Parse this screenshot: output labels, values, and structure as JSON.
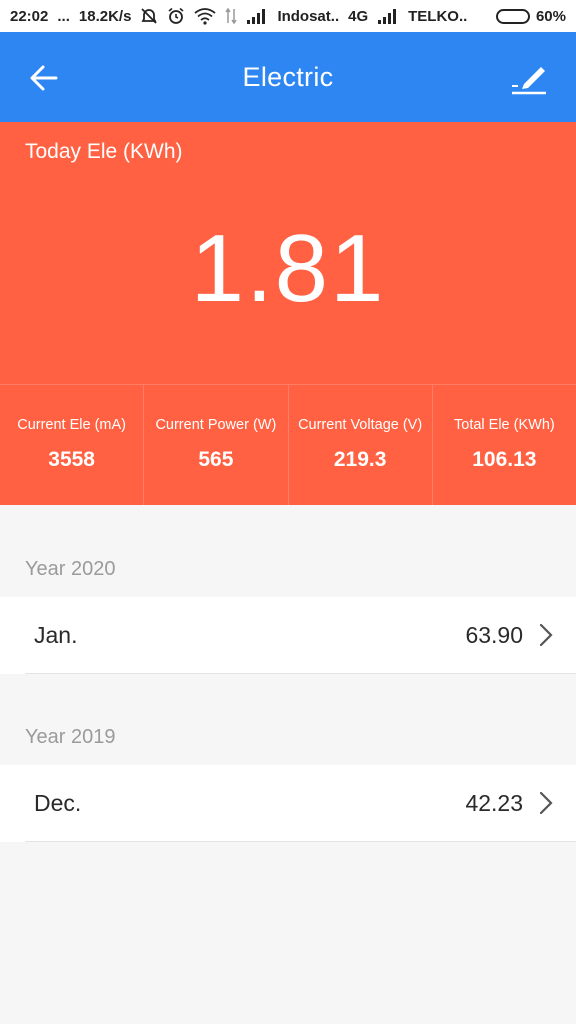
{
  "status_bar": {
    "time": "22:02",
    "dots": "...",
    "speed": "18.2K/s",
    "carrier1": "Indosat..",
    "network": "4G",
    "carrier2": "TELKO..",
    "battery": "60%",
    "battery_level": 0.6
  },
  "app_bar": {
    "title": "Electric"
  },
  "today": {
    "label": "Today Ele (KWh)",
    "value": "1.81"
  },
  "stats": [
    {
      "label": "Current Ele (mA)",
      "value": "3558"
    },
    {
      "label": "Current Power (W)",
      "value": "565"
    },
    {
      "label": "Current Voltage (V)",
      "value": "219.3"
    },
    {
      "label": "Total Ele (KWh)",
      "value": "106.13"
    }
  ],
  "years": [
    {
      "header": "Year 2020",
      "rows": [
        {
          "month": "Jan.",
          "value": "63.90"
        }
      ]
    },
    {
      "header": "Year 2019",
      "rows": [
        {
          "month": "Dec.",
          "value": "42.23"
        }
      ]
    }
  ],
  "colors": {
    "app_bar": "#2e86f2",
    "hero": "#ff6142",
    "background": "#f6f6f6"
  }
}
